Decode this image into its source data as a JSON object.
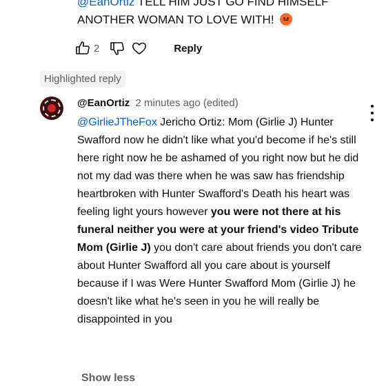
{
  "parent_comment": {
    "mention": "@EanOrtiz",
    "line1_rest": " TELL HIM JUST GO FIND HIMSELF",
    "line2": "ANOTHER WOMAN TO LOVE WITH!",
    "emoji": "angry-face-emoji",
    "like_count": "2",
    "reply_label": "Reply"
  },
  "highlighted_badge": "Highlighted reply",
  "reply": {
    "author": "@EanOrtiz",
    "meta": "2 minutes ago (edited)",
    "mention": "@GirlieJTheFox",
    "text_part1": " Jericho Ortiz: Mom (Girlie J) Hunter Swafford now he didn't like what you'd become if he's still here right now he be ashamed of you right now but he did not my dad was there when he was saw has friendship heartbroken with Hunter Swafford's Death his heart was feeling light yours however ",
    "text_bold": "you were not there at his funeral neither you were at your friend's video Tribute Mom (Girlie J)",
    "text_part2": " you don't care about friends you don't care about Hunter Swafford all you care about is yourself because if I was Were Hunter Swafford Mom (Girlie J) he doesn't like what he's seen in you he will really be disappointed in you",
    "show_less": "Show less"
  },
  "colors": {
    "link": "#065fd4",
    "muted": "#606060",
    "text": "#0f0f0f",
    "badge_bg": "#f2f2f2"
  }
}
